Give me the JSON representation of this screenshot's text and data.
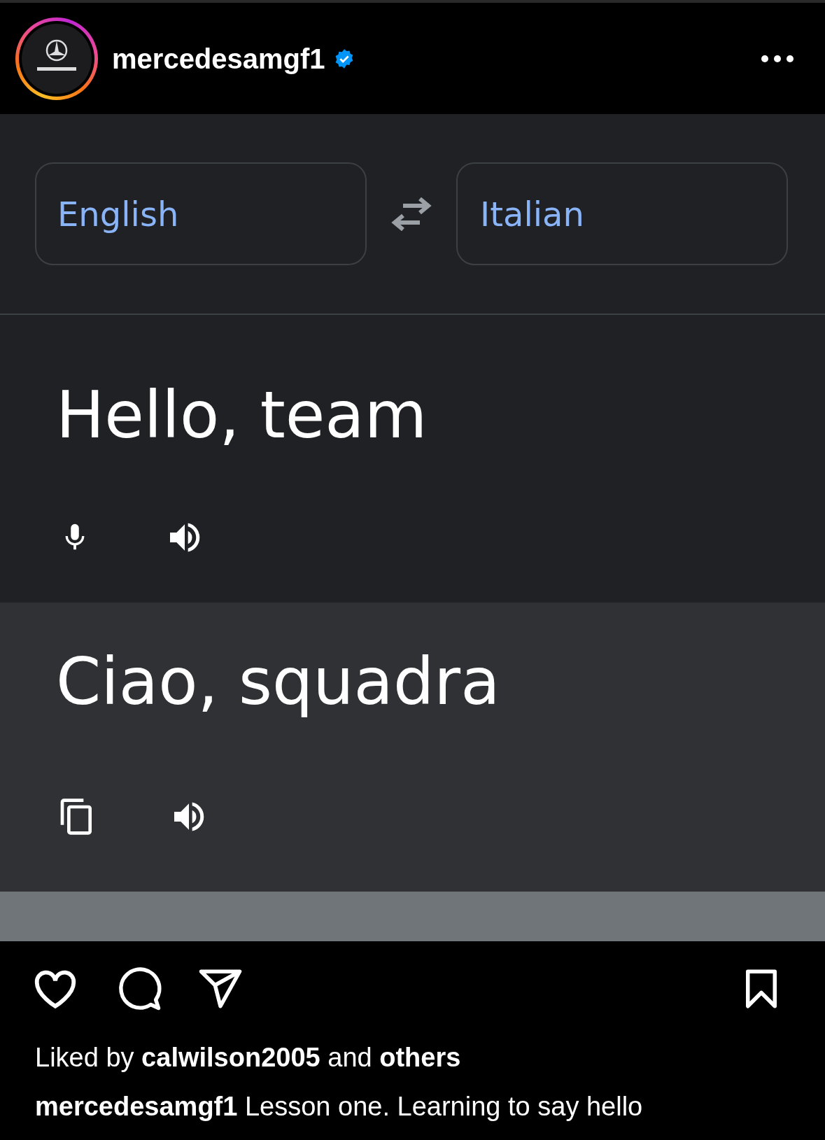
{
  "post_header": {
    "username": "mercedesamgf1",
    "verified": true
  },
  "translator": {
    "source_language": "English",
    "target_language": "Italian",
    "source_text": "Hello, team",
    "translated_text": "Ciao, squadra"
  },
  "likes": {
    "prefix": "Liked by",
    "user": "calwilson2005",
    "joiner": "and",
    "others": "others"
  },
  "caption": {
    "username": "mercedesamgf1",
    "text": "Lesson one. Learning to say hello"
  }
}
